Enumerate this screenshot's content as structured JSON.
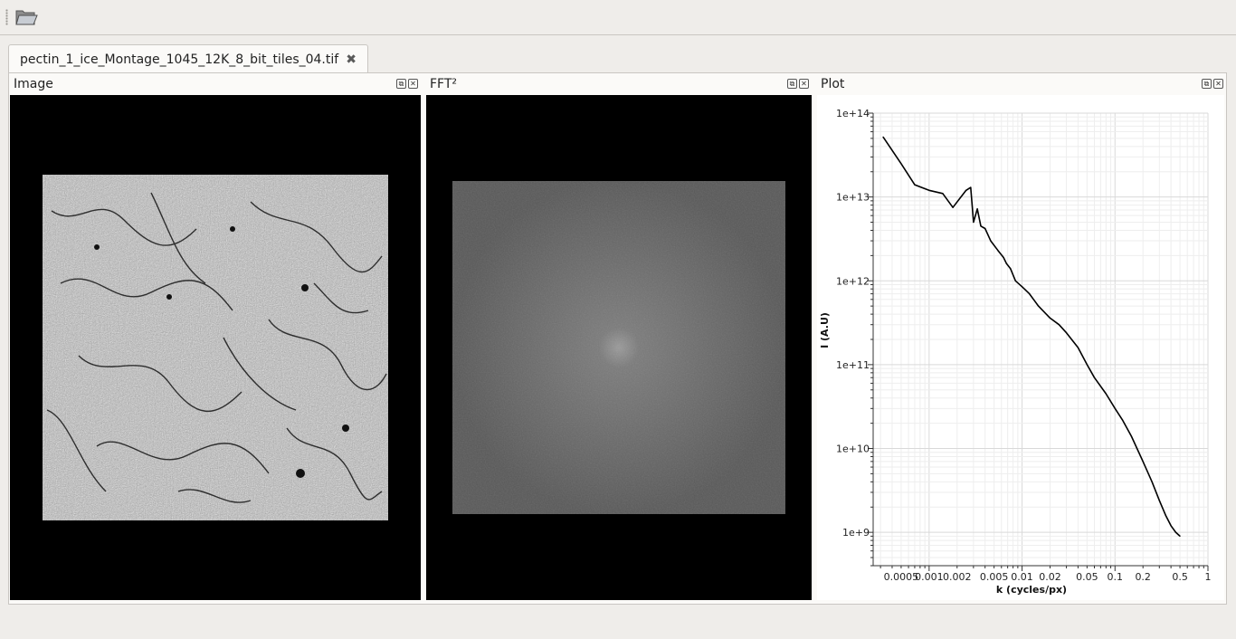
{
  "tab": {
    "title": "pectin_1_ice_Montage_1045_12K_8_bit_tiles_04.tif"
  },
  "docks": {
    "image": {
      "title": "Image"
    },
    "fft": {
      "title": "FFT²"
    },
    "plot": {
      "title": "Plot"
    }
  },
  "chart_data": {
    "type": "line",
    "xlabel": "k (cycles/px)",
    "ylabel": "I (A.U)",
    "xscale": "log",
    "yscale": "log",
    "xlim": [
      0.00025,
      1
    ],
    "ylim": [
      400000000.0,
      100000000000000.0
    ],
    "xticks": [
      "0.0005",
      "0.001",
      "0.002",
      "0.005",
      "0.01",
      "0.02",
      "0.05",
      "0.1",
      "0.2",
      "0.5",
      "1"
    ],
    "yticks": [
      "1e+9",
      "1e+10",
      "1e+11",
      "1e+12",
      "1e+13",
      "1e+14"
    ],
    "grid": true,
    "series": [
      {
        "x": [
          0.00032,
          0.0005,
          0.0007,
          0.001,
          0.0014,
          0.0018,
          0.0022,
          0.0025,
          0.0028,
          0.003,
          0.0033,
          0.0036,
          0.004,
          0.0046,
          0.0055,
          0.0063,
          0.0068,
          0.0075,
          0.0085,
          0.01,
          0.012,
          0.015,
          0.02,
          0.025,
          0.03,
          0.04,
          0.05,
          0.06,
          0.08,
          0.1,
          0.12,
          0.15,
          0.2,
          0.25,
          0.3,
          0.35,
          0.4,
          0.45,
          0.5
        ],
        "y": [
          52000000000000.0,
          25000000000000.0,
          14000000000000.0,
          12000000000000.0,
          11000000000000.0,
          7500000000000.0,
          10000000000000.0,
          12000000000000.0,
          13000000000000.0,
          5000000000000.0,
          7200000000000.0,
          4500000000000.0,
          4200000000000.0,
          3000000000000.0,
          2300000000000.0,
          1900000000000.0,
          1600000000000.0,
          1400000000000.0,
          1000000000000.0,
          850000000000.0,
          700000000000.0,
          500000000000.0,
          360000000000.0,
          300000000000.0,
          240000000000.0,
          160000000000.0,
          100000000000.0,
          70000000000.0,
          45000000000.0,
          30000000000.0,
          22000000000.0,
          14000000000.0,
          7000000000.0,
          4000000000.0,
          2400000000.0,
          1600000000.0,
          1200000000.0,
          1000000000.0,
          900000000.0
        ]
      }
    ]
  }
}
